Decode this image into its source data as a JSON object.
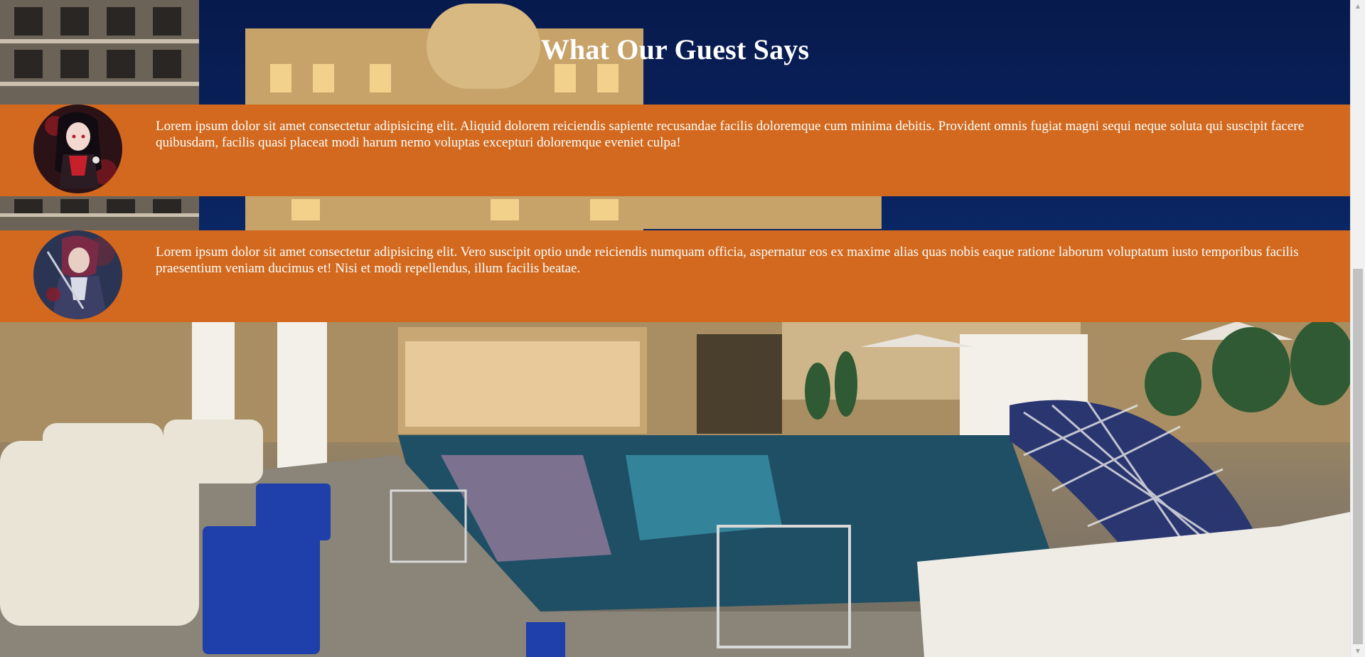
{
  "section": {
    "title": "What Our Guest Says"
  },
  "testimonials": [
    {
      "text": "Lorem ipsum dolor sit amet consectetur adipisicing elit. Aliquid dolorem reiciendis sapiente recusandae facilis doloremque cum minima debitis. Provident omnis fugiat magni sequi neque soluta qui suscipit facere quibusdam, facilis quasi placeat modi harum nemo voluptas excepturi doloremque eveniet culpa!",
      "avatar": "anime-girl-avatar"
    },
    {
      "text": "Lorem ipsum dolor sit amet consectetur adipisicing elit. Vero suscipit optio unde reiciendis numquam officia, aspernatur eos ex maxime alias quas nobis eaque ratione laborum voluptatum iusto temporibus facilis praesentium veniam ducimus et! Nisi et modi repellendus, illum facilis beatae.",
      "avatar": "anime-swordsman-avatar"
    }
  ],
  "colors": {
    "band": "#d2691e",
    "heading": "#ffffff",
    "sky": "#0a2460"
  },
  "scrollbar": {
    "up_glyph": "▲",
    "down_glyph": "▼"
  }
}
